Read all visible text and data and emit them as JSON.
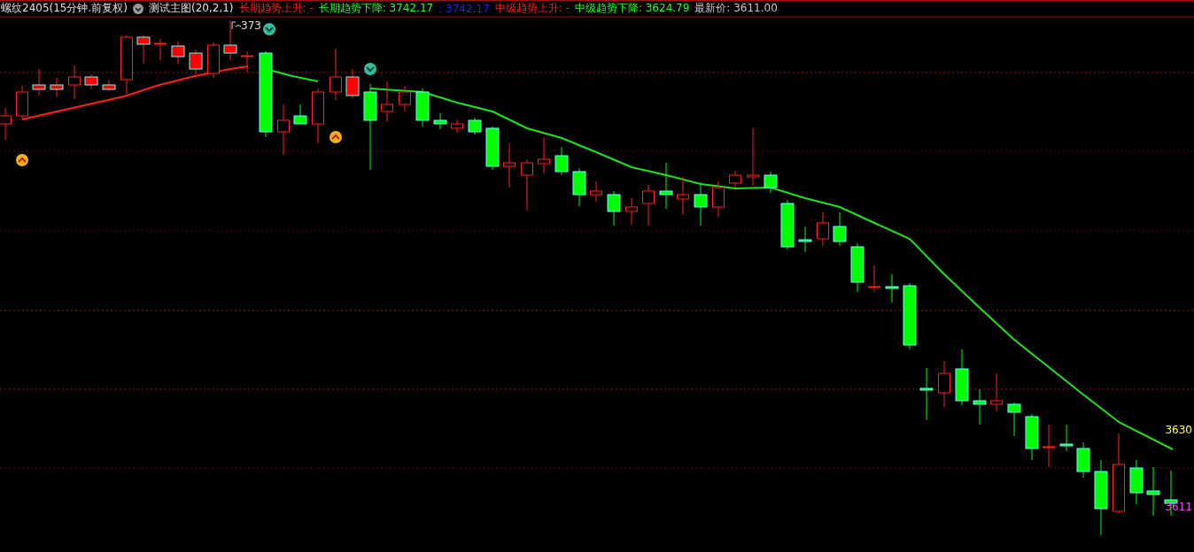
{
  "header": {
    "symbol": "螺纹2405(15分钟.前复权)",
    "indicator": "测试主图(20,2,1)",
    "values": [
      {
        "text": "长期趋势上升: -",
        "kind": "rise"
      },
      {
        "text": "长期趋势下降: 3742.17",
        "kind": "fall"
      },
      {
        "text": ": 3742.17",
        "kind": "level"
      },
      {
        "text": "中级趋势上升: -",
        "kind": "rise"
      },
      {
        "text": "中级趋势下降: 3624.79",
        "kind": "fall"
      },
      {
        "text": "最新价: 3611.00",
        "kind": "last"
      }
    ]
  },
  "chart": {
    "peak_label": "373",
    "price_labels": [
      {
        "text": "3630",
        "color": "#ffff40"
      },
      {
        "text": "3611",
        "color": "#ff40ff"
      }
    ]
  }
}
